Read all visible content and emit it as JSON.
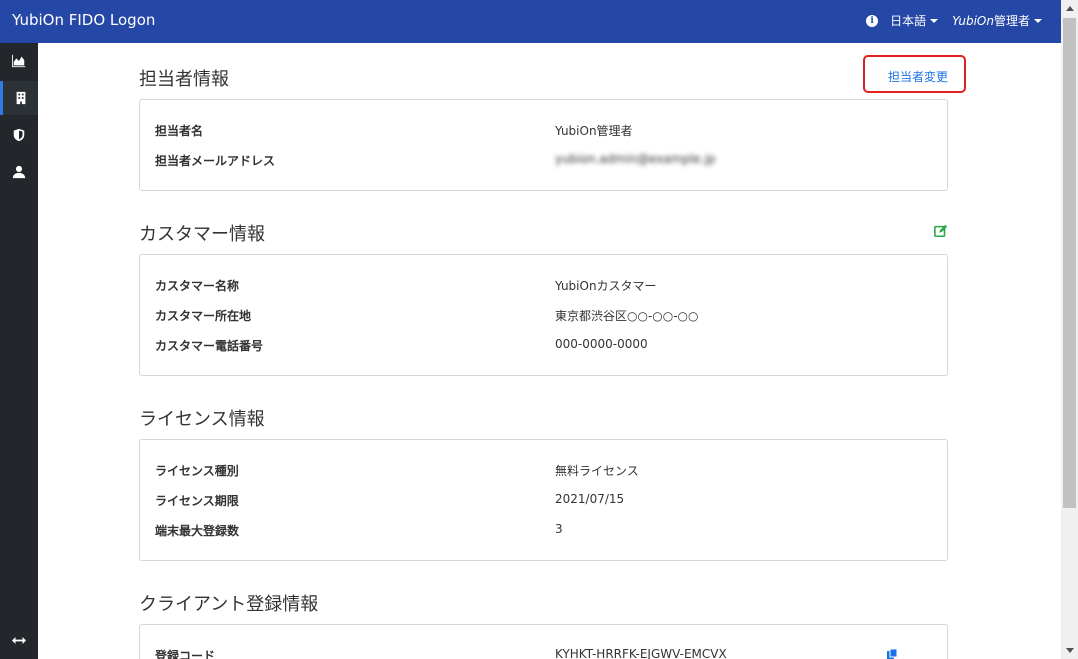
{
  "header": {
    "brand": "YubiOn FIDO Logon",
    "language": "日本語",
    "user_italic": "YubiOn",
    "user_rest": "管理者"
  },
  "sidebar": {
    "items": [
      {
        "icon": "area-chart-icon"
      },
      {
        "icon": "building-icon",
        "active": true
      },
      {
        "icon": "shield-icon"
      },
      {
        "icon": "user-icon"
      }
    ],
    "bottom_icon": "expand-arrows-icon"
  },
  "contact": {
    "title": "担当者情報",
    "change_link": "担当者変更",
    "rows": [
      {
        "label": "担当者名",
        "value": "YubiOn管理者"
      },
      {
        "label": "担当者メールアドレス",
        "value": "yubion.admin@example.jp"
      }
    ]
  },
  "customer": {
    "title": "カスタマー情報",
    "edit_icon": "edit-icon",
    "rows": [
      {
        "label": "カスタマー名称",
        "value": "YubiOnカスタマー"
      },
      {
        "label": "カスタマー所在地",
        "value": "東京都渋谷区○○-○○-○○"
      },
      {
        "label": "カスタマー電話番号",
        "value": "000-0000-0000"
      }
    ]
  },
  "license": {
    "title": "ライセンス情報",
    "rows": [
      {
        "label": "ライセンス種別",
        "value": "無料ライセンス"
      },
      {
        "label": "ライセンス期限",
        "value": "2021/07/15"
      },
      {
        "label": "端末最大登録数",
        "value": "3"
      }
    ]
  },
  "client": {
    "title": "クライアント登録情報",
    "rows": [
      {
        "label": "登録コード",
        "value": "KYHKT-HRRFK-EJGWV-EMCVX"
      }
    ]
  },
  "colors": {
    "navbar": "#2548a6",
    "sidebar": "#23272b",
    "link": "#1a73e8",
    "highlight": "#e02020",
    "edit": "#28a745"
  }
}
